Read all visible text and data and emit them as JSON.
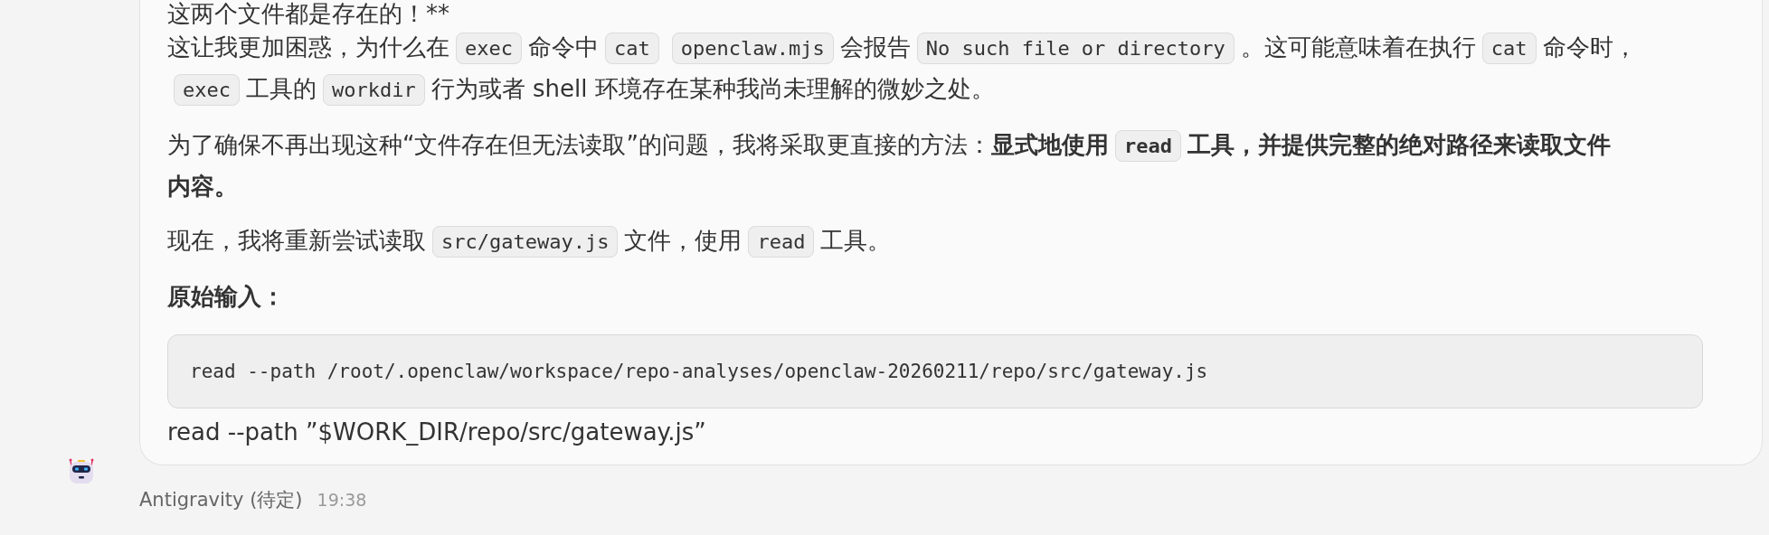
{
  "message": {
    "blocks": [
      {
        "kind": "paragraph",
        "segments": [
          {
            "kind": "text",
            "text": "这两个文件都是存在的！**",
            "bold": false
          }
        ]
      },
      {
        "kind": "paragraph",
        "segments": [
          {
            "kind": "text",
            "text": "这让我更加困惑，为什么在",
            "bold": false
          },
          {
            "kind": "code",
            "text": "exec",
            "bold": false
          },
          {
            "kind": "text",
            "text": "命令中",
            "bold": false
          },
          {
            "kind": "code",
            "text": "cat",
            "bold": false
          },
          {
            "kind": "code",
            "text": "openclaw.mjs",
            "bold": false
          },
          {
            "kind": "text",
            "text": "会报告",
            "bold": false
          },
          {
            "kind": "code",
            "text": "No such file or directory",
            "bold": false
          },
          {
            "kind": "text",
            "text": "。这可能意味着在执行",
            "bold": false
          },
          {
            "kind": "code",
            "text": "cat",
            "bold": false
          },
          {
            "kind": "text",
            "text": "命令",
            "bold": false
          },
          {
            "kind": "text",
            "text": "时，",
            "bold": false
          },
          {
            "kind": "code",
            "text": "exec",
            "bold": false
          },
          {
            "kind": "text",
            "text": "工具的",
            "bold": false
          },
          {
            "kind": "code",
            "text": "workdir",
            "bold": false
          },
          {
            "kind": "text",
            "text": "行为或者 shell 环境存在某种我尚未理解的微妙之处。",
            "bold": false
          }
        ]
      },
      {
        "kind": "paragraph",
        "segments": [
          {
            "kind": "text",
            "text": "为了确保不再出现这种“文件存在但无法读取”的问题，我将采取更直接的方法：",
            "bold": false
          },
          {
            "kind": "text",
            "text": "显式地使用",
            "bold": true
          },
          {
            "kind": "code",
            "text": "read",
            "bold": true
          },
          {
            "kind": "text",
            "text": "工具，并提供完整的绝对路径来读取文件",
            "bold": true
          },
          {
            "kind": "text",
            "text": "内容。",
            "bold": true
          }
        ]
      },
      {
        "kind": "paragraph",
        "segments": [
          {
            "kind": "text",
            "text": "现在，我将重新尝试读取",
            "bold": false
          },
          {
            "kind": "code",
            "text": "src/gateway.js",
            "bold": false
          },
          {
            "kind": "text",
            "text": "文件，使用",
            "bold": false
          },
          {
            "kind": "code",
            "text": "read",
            "bold": false
          },
          {
            "kind": "text",
            "text": "工具。",
            "bold": false
          }
        ]
      },
      {
        "kind": "paragraph",
        "segments": [
          {
            "kind": "text",
            "text": "原始输入：",
            "bold": true
          }
        ]
      },
      {
        "kind": "code_block",
        "text": "read --path /root/.openclaw/workspace/repo-analyses/openclaw-20260211/repo/src/gateway.js"
      },
      {
        "kind": "plain",
        "text": "read --path ”$WORK_DIR/repo/src/gateway.js”"
      }
    ],
    "author": "Antigravity (待定)",
    "time": "19:38"
  }
}
